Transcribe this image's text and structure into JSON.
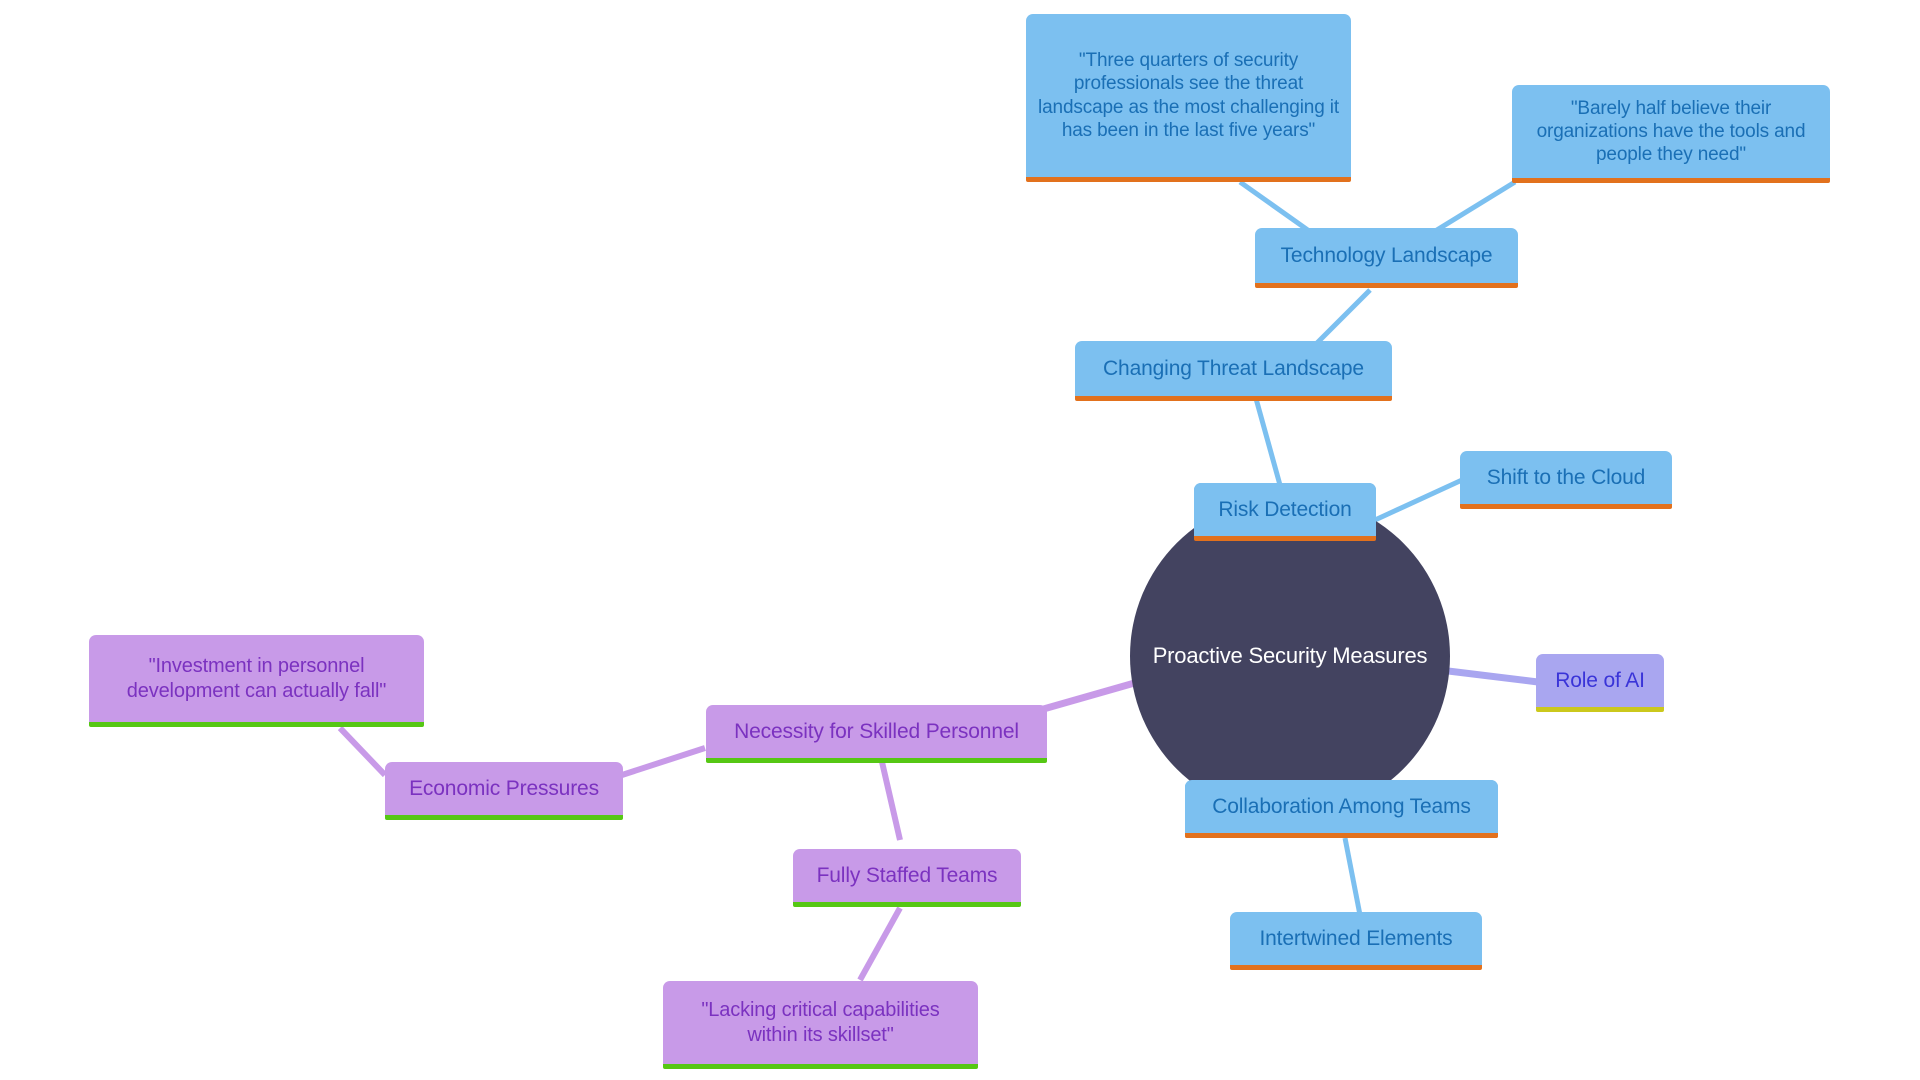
{
  "diagram": {
    "type": "mind-map",
    "background": "#ffffff",
    "center": {
      "label": "Proactive Security Measures",
      "fill": "#434360",
      "text_color": "#ffffff"
    },
    "palette": {
      "blue_fill": "#7cc0f0",
      "blue_text": "#1a6fb5",
      "blue_underline": "#e2711d",
      "purple_fill": "#c89ae8",
      "purple_text": "#7b32c0",
      "purple_underline": "#56c714",
      "periwinkle_fill": "#a9a6f0",
      "periwinkle_text": "#3a34d8",
      "periwinkle_underline": "#cbc81c",
      "edge_blue": "#7cc0f0",
      "edge_purple": "#c89ae8",
      "edge_periwinkle": "#a9a6f0"
    },
    "nodes": [
      {
        "id": "quote_three_quarters",
        "label": "\"Three quarters of security professionals see the threat landscape as the most challenging it has been in the last five years\"",
        "branch": "blue"
      },
      {
        "id": "quote_barely_half",
        "label": "\"Barely half believe their organizations have the tools and people they need\"",
        "branch": "blue"
      },
      {
        "id": "technology_landscape",
        "label": "Technology Landscape",
        "branch": "blue"
      },
      {
        "id": "changing_threat_landscape",
        "label": "Changing Threat Landscape",
        "branch": "blue"
      },
      {
        "id": "risk_detection",
        "label": "Risk Detection",
        "branch": "blue"
      },
      {
        "id": "shift_to_the_cloud",
        "label": "Shift to the Cloud",
        "branch": "blue"
      },
      {
        "id": "role_of_ai",
        "label": "Role of AI",
        "branch": "periwinkle"
      },
      {
        "id": "collaboration_among_teams",
        "label": "Collaboration Among Teams",
        "branch": "blue"
      },
      {
        "id": "intertwined_elements",
        "label": "Intertwined Elements",
        "branch": "blue"
      },
      {
        "id": "necessity_for_skilled_personnel",
        "label": "Necessity for Skilled Personnel",
        "branch": "purple"
      },
      {
        "id": "economic_pressures",
        "label": "Economic Pressures",
        "branch": "purple"
      },
      {
        "id": "quote_investment",
        "label": "\"Investment in personnel development can actually fall\"",
        "branch": "purple"
      },
      {
        "id": "fully_staffed_teams",
        "label": "Fully Staffed Teams",
        "branch": "purple"
      },
      {
        "id": "quote_lacking",
        "label": "\"Lacking critical capabilities within its skillset\"",
        "branch": "purple"
      }
    ],
    "edges": [
      {
        "from": "center",
        "to": "risk_detection"
      },
      {
        "from": "risk_detection",
        "to": "shift_to_the_cloud"
      },
      {
        "from": "risk_detection",
        "to": "changing_threat_landscape"
      },
      {
        "from": "changing_threat_landscape",
        "to": "technology_landscape"
      },
      {
        "from": "technology_landscape",
        "to": "quote_three_quarters"
      },
      {
        "from": "technology_landscape",
        "to": "quote_barely_half"
      },
      {
        "from": "center",
        "to": "role_of_ai"
      },
      {
        "from": "center",
        "to": "collaboration_among_teams"
      },
      {
        "from": "collaboration_among_teams",
        "to": "intertwined_elements"
      },
      {
        "from": "center",
        "to": "necessity_for_skilled_personnel"
      },
      {
        "from": "necessity_for_skilled_personnel",
        "to": "economic_pressures"
      },
      {
        "from": "economic_pressures",
        "to": "quote_investment"
      },
      {
        "from": "necessity_for_skilled_personnel",
        "to": "fully_staffed_teams"
      },
      {
        "from": "fully_staffed_teams",
        "to": "quote_lacking"
      }
    ]
  }
}
